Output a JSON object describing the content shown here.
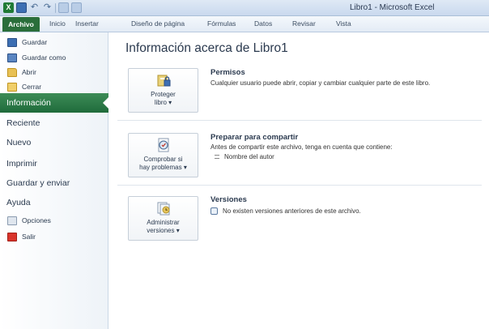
{
  "window": {
    "title": "Libro1 - Microsoft Excel",
    "app_icon": "X"
  },
  "ribbon": {
    "tabs": [
      {
        "label": "Archivo"
      },
      {
        "label": "Inicio"
      },
      {
        "label": "Insertar"
      },
      {
        "label": "Diseño de página"
      },
      {
        "label": "Fórmulas"
      },
      {
        "label": "Datos"
      },
      {
        "label": "Revisar"
      },
      {
        "label": "Vista"
      }
    ]
  },
  "nav": {
    "items": [
      {
        "label": "Guardar",
        "icon": "save-icon"
      },
      {
        "label": "Guardar como",
        "icon": "save-as-icon"
      },
      {
        "label": "Abrir",
        "icon": "folder-open-icon"
      },
      {
        "label": "Cerrar",
        "icon": "folder-close-icon"
      },
      {
        "label": "Información",
        "active": true
      },
      {
        "label": "Reciente"
      },
      {
        "label": "Nuevo"
      },
      {
        "label": "Imprimir"
      },
      {
        "label": "Guardar y enviar"
      },
      {
        "label": "Ayuda"
      },
      {
        "label": "Opciones",
        "icon": "options-icon"
      },
      {
        "label": "Salir",
        "icon": "exit-icon"
      }
    ]
  },
  "main": {
    "title": "Información acerca de Libro1",
    "sections": [
      {
        "button_label": "Proteger\nlibro ▾",
        "icon": "lock-key-icon",
        "heading": "Permisos",
        "description": "Cualquier usuario puede abrir, copiar y cambiar cualquier parte de este libro."
      },
      {
        "button_label": "Comprobar si\nhay problemas ▾",
        "icon": "inspect-document-icon",
        "heading": "Preparar para compartir",
        "description": "Antes de compartir este archivo, tenga en cuenta que contiene:",
        "bullet": "Nombre del autor"
      },
      {
        "button_label": "Administrar\nversiones ▾",
        "icon": "versions-icon",
        "heading": "Versiones",
        "bullet": "No existen versiones anteriores de este archivo."
      }
    ]
  },
  "colors": {
    "file_tab": "#2a6e3a",
    "active_nav": "#217346",
    "title_bar": "#c9d9ee"
  }
}
